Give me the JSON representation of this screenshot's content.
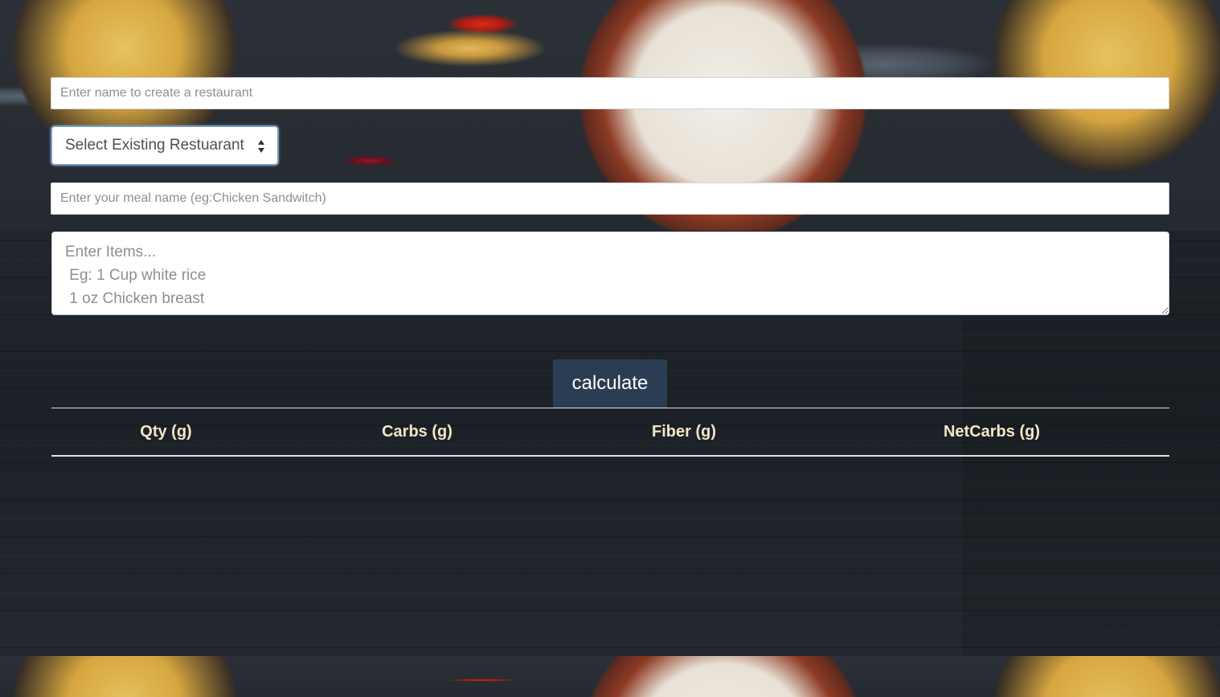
{
  "restaurant_input": {
    "placeholder": "Enter name to create a restaurant",
    "value": ""
  },
  "restaurant_select": {
    "selected_label": "Select Existing Restuarant",
    "icon": "updown-arrows-icon"
  },
  "meal_input": {
    "placeholder": "Enter your meal name (eg:Chicken Sandwitch)",
    "value": ""
  },
  "items_textarea": {
    "placeholder": "Enter Items...\n Eg: 1 Cup white rice\n 1 oz Chicken breast",
    "value": ""
  },
  "calculate_button": {
    "label": "calculate"
  },
  "results_table": {
    "columns": [
      "Qty (g)",
      "Carbs (g)",
      "Fiber (g)",
      "NetCarbs (g)"
    ],
    "rows": []
  },
  "colors": {
    "button_bg": "#2b3d52",
    "header_text": "#f3e6c9",
    "page_bg": "#1f252c"
  }
}
